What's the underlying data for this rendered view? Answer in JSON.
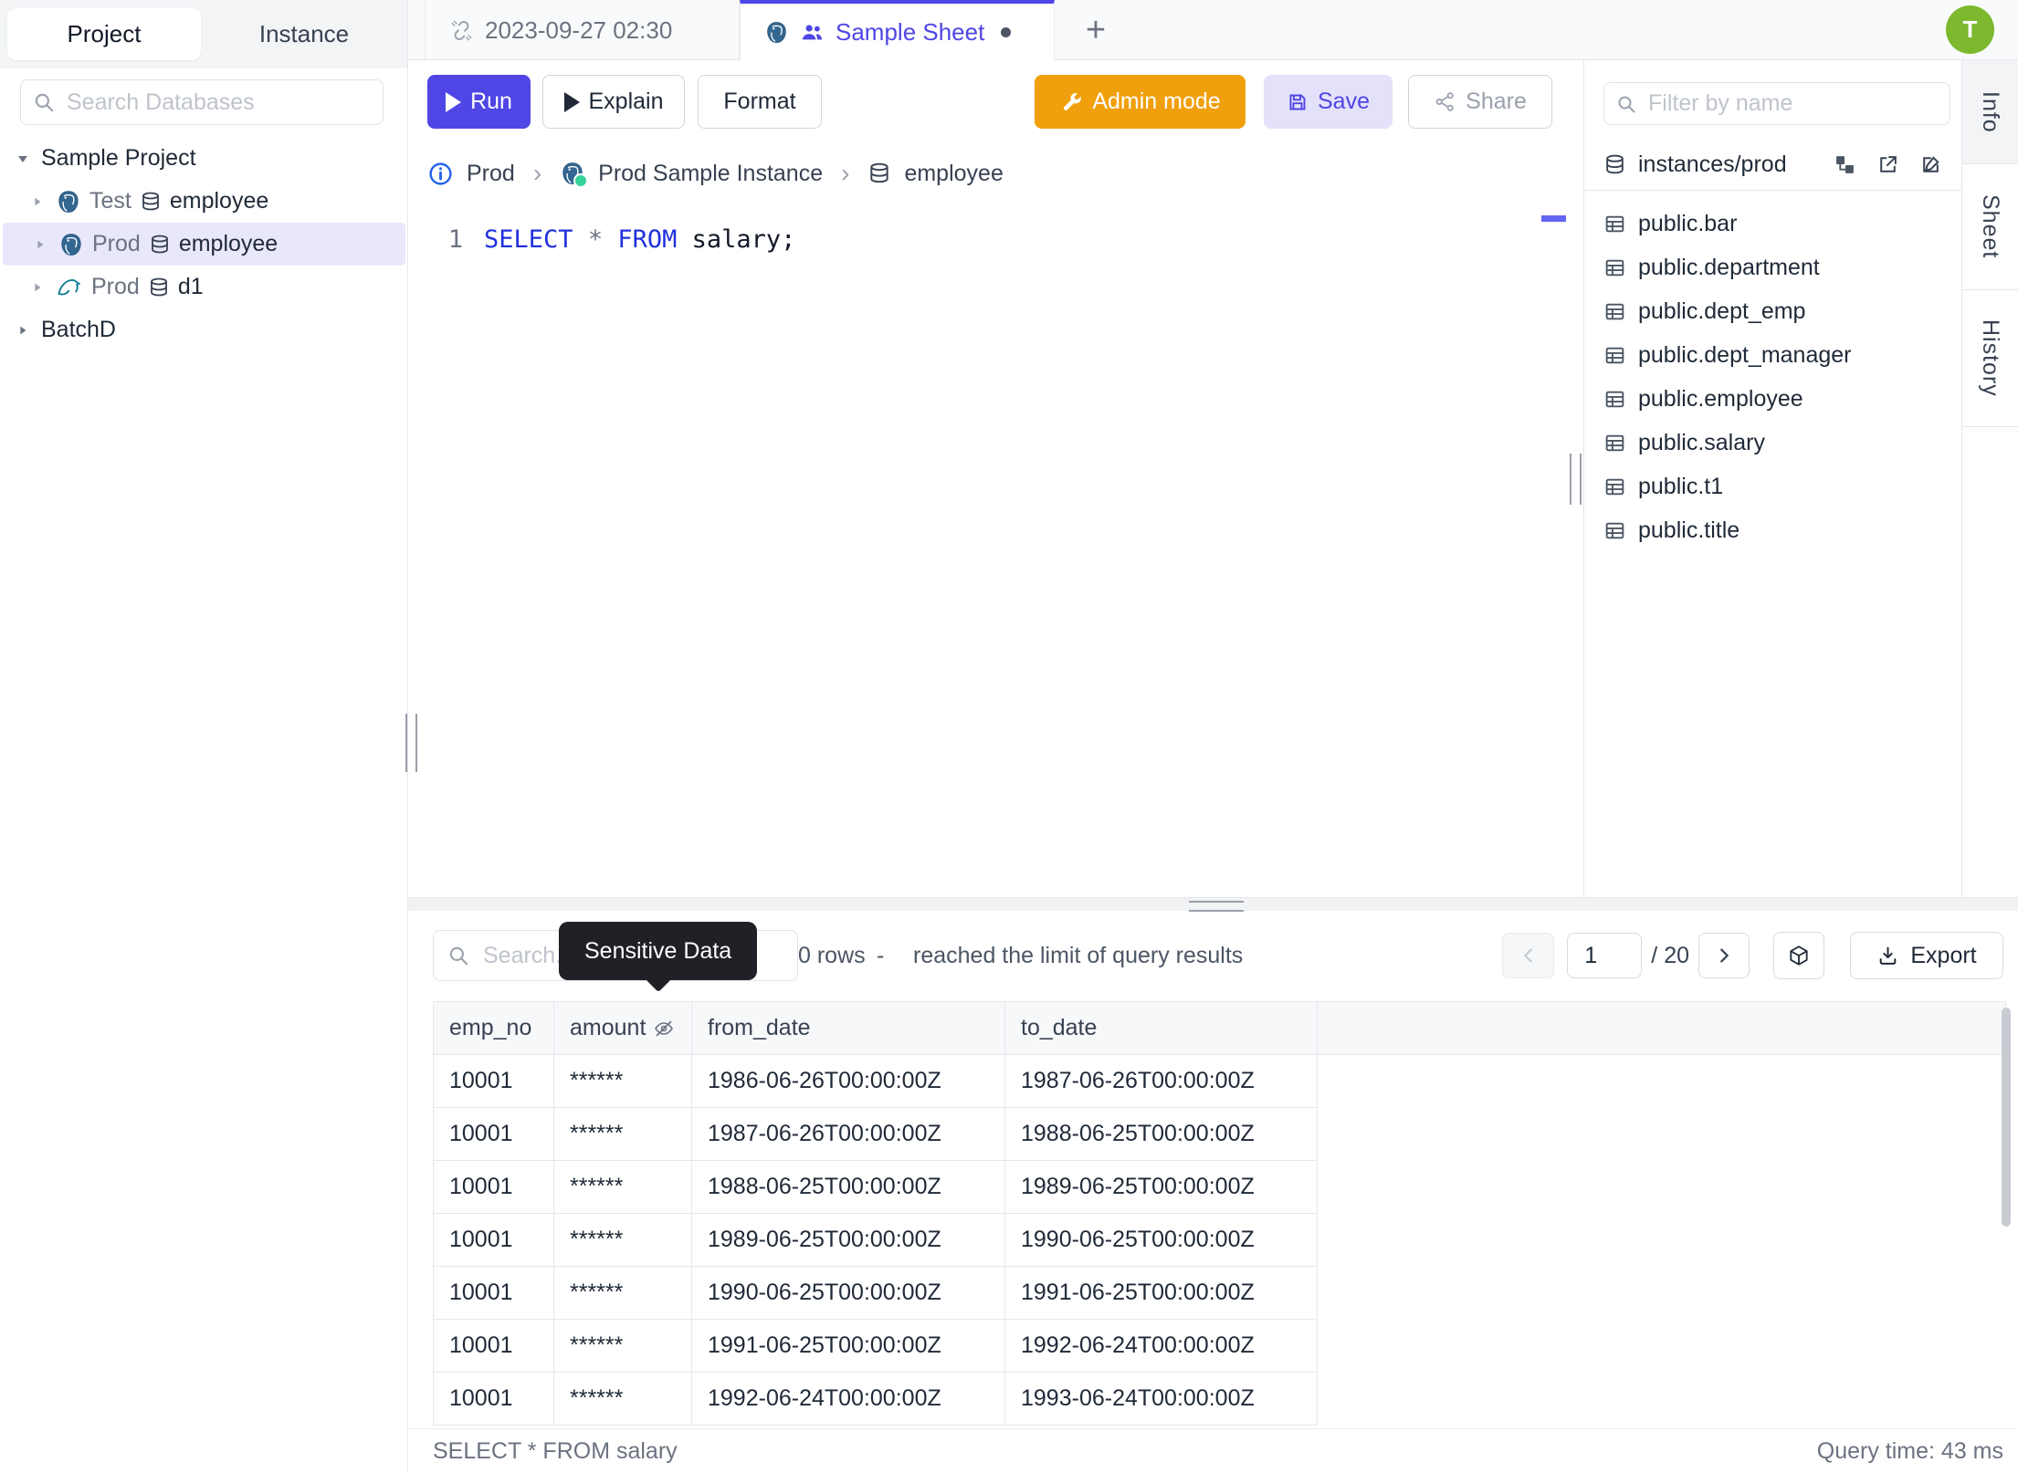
{
  "sidebar": {
    "tabs": {
      "project": "Project",
      "instance": "Instance"
    },
    "search_placeholder": "Search Databases",
    "tree": {
      "project_label": "Sample Project",
      "items": [
        {
          "instance": "Test",
          "database": "employee"
        },
        {
          "instance": "Prod",
          "database": "employee"
        },
        {
          "instance": "Prod",
          "database": "d1"
        }
      ],
      "batch_label": "BatchD"
    }
  },
  "tabbar": {
    "tab_time": "2023-09-27 02:30",
    "tab_sheet": "Sample Sheet",
    "new_tab": "+",
    "avatar": "T"
  },
  "toolbar": {
    "run": "Run",
    "explain": "Explain",
    "format": "Format",
    "admin_mode": "Admin mode",
    "save": "Save",
    "share": "Share"
  },
  "breadcrumb": {
    "environment": "Prod",
    "instance": "Prod Sample Instance",
    "database": "employee"
  },
  "editor": {
    "line_number": "1",
    "kw_select": "SELECT",
    "op_star": "*",
    "kw_from": "FROM",
    "identifier": "salary;"
  },
  "schema_panel": {
    "filter_placeholder": "Filter by name",
    "source": "instances/prod",
    "tables": [
      "public.bar",
      "public.department",
      "public.dept_emp",
      "public.dept_manager",
      "public.employee",
      "public.salary",
      "public.t1",
      "public.title"
    ]
  },
  "rail": {
    "info": "Info",
    "sheet": "Sheet",
    "history": "History"
  },
  "results": {
    "search_placeholder": "Search...",
    "tooltip": "Sensitive Data",
    "row_count": "0 rows",
    "dash": "-",
    "limit_note": "reached the limit of query results",
    "pagination": {
      "page": "1",
      "total": "/ 20"
    },
    "export_label": "Export",
    "columns": {
      "c0": "emp_no",
      "c1": "amount",
      "c2": "from_date",
      "c3": "to_date"
    },
    "rows": [
      [
        "10001",
        "******",
        "1986-06-26T00:00:00Z",
        "1987-06-26T00:00:00Z"
      ],
      [
        "10001",
        "******",
        "1987-06-26T00:00:00Z",
        "1988-06-25T00:00:00Z"
      ],
      [
        "10001",
        "******",
        "1988-06-25T00:00:00Z",
        "1989-06-25T00:00:00Z"
      ],
      [
        "10001",
        "******",
        "1989-06-25T00:00:00Z",
        "1990-06-25T00:00:00Z"
      ],
      [
        "10001",
        "******",
        "1990-06-25T00:00:00Z",
        "1991-06-25T00:00:00Z"
      ],
      [
        "10001",
        "******",
        "1991-06-25T00:00:00Z",
        "1992-06-24T00:00:00Z"
      ],
      [
        "10001",
        "******",
        "1992-06-24T00:00:00Z",
        "1993-06-24T00:00:00Z"
      ]
    ],
    "statement": "SELECT * FROM salary",
    "query_time": "Query time: 43 ms"
  }
}
